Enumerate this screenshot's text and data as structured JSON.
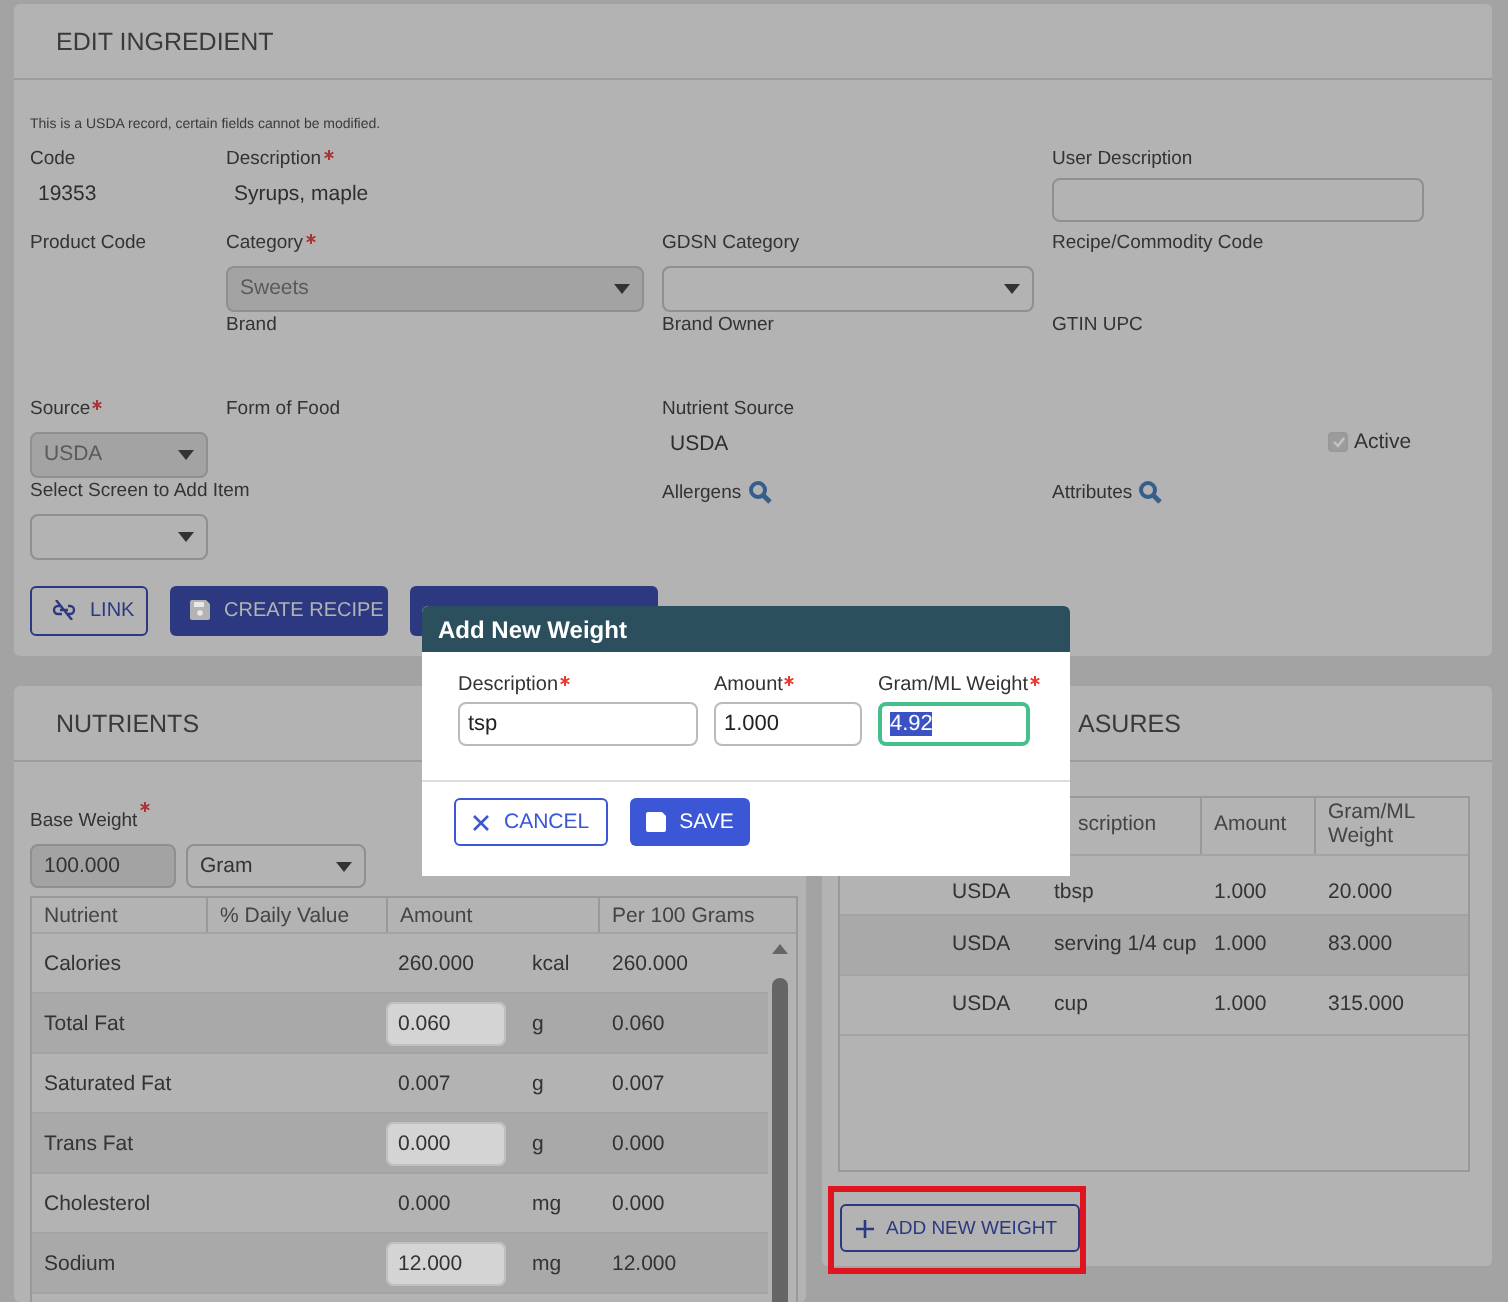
{
  "edit_ingredient": {
    "title": "EDIT INGREDIENT",
    "notice": "This is a USDA record, certain fields cannot be modified.",
    "rows": [
      [
        {
          "kind": "text",
          "label": "Code",
          "value": "19353"
        },
        {
          "kind": "text",
          "label": "Description",
          "required": true,
          "value": "Syrups, maple"
        },
        {
          "kind": "blank"
        },
        {
          "kind": "input",
          "label": "User Description"
        }
      ],
      [
        {
          "kind": "label",
          "label": "Product Code"
        },
        {
          "kind": "select",
          "label": "Category",
          "required": true,
          "value": "Sweets",
          "disabled": true
        },
        {
          "kind": "select",
          "label": "GDSN Category",
          "disabled": false
        },
        {
          "kind": "label",
          "label": "Recipe/Commodity Code"
        }
      ],
      [
        {
          "kind": "blank"
        },
        {
          "kind": "label",
          "label": "Brand"
        },
        {
          "kind": "label",
          "label": "Brand Owner"
        },
        {
          "kind": "label",
          "label": "GTIN UPC"
        }
      ],
      [
        {
          "kind": "select",
          "label": "Source",
          "required": true,
          "value": "USDA",
          "disabled": true
        },
        {
          "kind": "label",
          "label": "Form of Food"
        },
        {
          "kind": "text",
          "label": "Nutrient Source",
          "value": "USDA"
        },
        {
          "kind": "checkbox",
          "label": "Active",
          "checked": true
        }
      ],
      [
        {
          "kind": "select",
          "label": "Select Screen to Add Item",
          "disabled": false
        },
        {
          "kind": "blank"
        },
        {
          "kind": "lookup",
          "label": "Allergens"
        },
        {
          "kind": "lookup",
          "label": "Attributes"
        }
      ]
    ],
    "buttons": [
      {
        "kind": "link",
        "label": "LINK"
      },
      {
        "kind": "create",
        "label": "CREATE RECIPE"
      },
      {
        "kind": "covered"
      }
    ]
  },
  "nutrients": {
    "title": "NUTRIENTS",
    "base_weight": {
      "label": "Base Weight",
      "required": true,
      "value": "100.000",
      "unit": "Gram"
    },
    "columns": [
      "Nutrient",
      "% Daily Value",
      "Amount",
      "Per 100 Grams"
    ],
    "rows": [
      {
        "name": "Calories",
        "amount": "260.000",
        "editable": false,
        "unit": "kcal",
        "per_100": "260.000"
      },
      {
        "name": "Total Fat",
        "amount": "0.060",
        "editable": true,
        "unit": "g",
        "per_100": "0.060"
      },
      {
        "name": "Saturated Fat",
        "amount": "0.007",
        "editable": false,
        "unit": "g",
        "per_100": "0.007"
      },
      {
        "name": "Trans Fat",
        "amount": "0.000",
        "editable": true,
        "unit": "g",
        "per_100": "0.000"
      },
      {
        "name": "Cholesterol",
        "amount": "0.000",
        "editable": false,
        "unit": "mg",
        "per_100": "0.000"
      },
      {
        "name": "Sodium",
        "amount": "12.000",
        "editable": true,
        "unit": "mg",
        "per_100": "12.000"
      }
    ]
  },
  "measures": {
    "title": "ASURES",
    "columns": [
      "scription",
      "Amount",
      "Gram/ML Weight"
    ],
    "rows": [
      {
        "source": "USDA",
        "description": "tbsp",
        "amount": "1.000",
        "weight": "20.000"
      },
      {
        "source": "USDA",
        "description": "serving 1/4 cup",
        "amount": "1.000",
        "weight": "83.000"
      },
      {
        "source": "USDA",
        "description": "cup",
        "amount": "1.000",
        "weight": "315.000"
      }
    ],
    "add_button": {
      "label": "ADD NEW WEIGHT",
      "highlighted": true
    }
  },
  "dialog": {
    "title": "Add New Weight",
    "fields": [
      {
        "label": "Description",
        "required": true,
        "value": "tsp",
        "focused": false
      },
      {
        "label": "Amount",
        "required": true,
        "value": "1.000",
        "focused": false
      },
      {
        "label": "Gram/ML Weight",
        "required": true,
        "value": "4.92",
        "focused": true
      }
    ],
    "buttons": [
      {
        "kind": "cancel",
        "label": "CANCEL"
      },
      {
        "kind": "save",
        "label": "SAVE"
      }
    ]
  }
}
